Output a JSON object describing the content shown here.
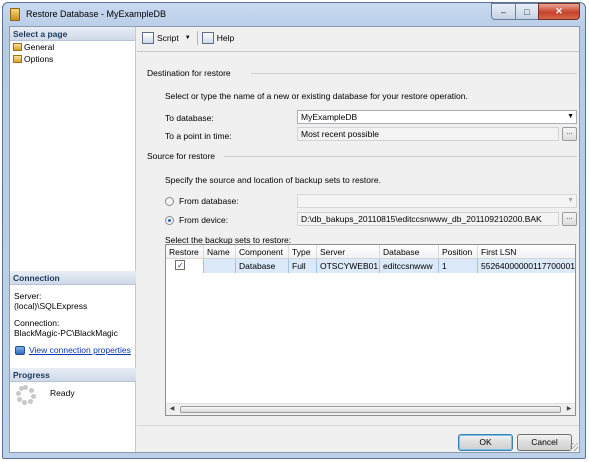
{
  "window": {
    "title": "Restore Database - MyExampleDB"
  },
  "left_pane": {
    "select_page_header": "Select a page",
    "pages": [
      {
        "label": "General",
        "icon": "page-icon"
      },
      {
        "label": "Options",
        "icon": "page-icon"
      }
    ],
    "connection": {
      "header": "Connection",
      "server_label": "Server:",
      "server_value": "(local)\\SQLExpress",
      "connection_label": "Connection:",
      "connection_value": "BlackMagic-PC\\BlackMagic",
      "view_link": "View connection properties"
    },
    "progress": {
      "header": "Progress",
      "status": "Ready"
    }
  },
  "toolbar": {
    "script_label": "Script",
    "help_label": "Help"
  },
  "destination": {
    "header": "Destination for restore",
    "description": "Select or type the name of a new or existing database for your restore operation.",
    "to_database_label": "To database:",
    "to_database_value": "MyExampleDB",
    "point_in_time_label": "To a point in time:",
    "point_in_time_value": "Most recent possible",
    "browse_label": "..."
  },
  "source": {
    "header": "Source for restore",
    "description": "Specify the source and location of backup sets to restore.",
    "from_database_label": "From database:",
    "from_database_value": "",
    "from_device_label": "From device:",
    "from_device_value": "D:\\db_bakups_20110815\\editccsnwww_db_201109210200.BAK",
    "selected_source": "device",
    "backup_sets_label": "Select the backup sets to restore:"
  },
  "backup_grid": {
    "columns": [
      "Restore",
      "Name",
      "Component",
      "Type",
      "Server",
      "Database",
      "Position",
      "First LSN"
    ],
    "rows": [
      {
        "restore": true,
        "name": "",
        "component": "Database",
        "type": "Full",
        "server": "OTSCYWEB01",
        "database": "editccsnwww",
        "position": "1",
        "first_lsn": "55264000000117700001"
      }
    ]
  },
  "buttons": {
    "ok": "OK",
    "cancel": "Cancel"
  },
  "colors": {
    "title_bar": "#c9daf0",
    "selection": "#dbe9f9",
    "link": "#0b36b8",
    "close_button": "#c7432b"
  }
}
